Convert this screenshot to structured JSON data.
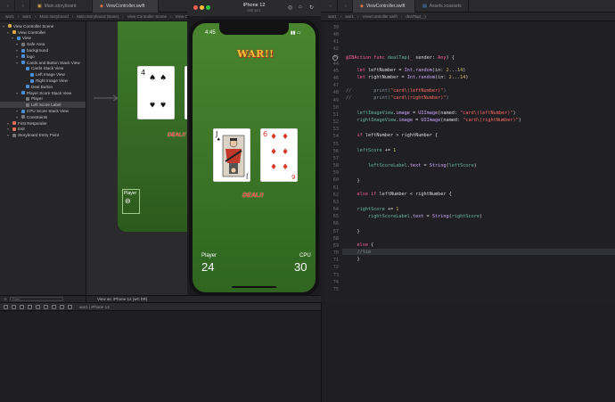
{
  "simulator": {
    "title": "iPhone 12",
    "subtitle": "iOS 14.2",
    "status_time": "4:45",
    "logo_text": "WAR!!",
    "left_card": {
      "rank": "J",
      "suit": "♠"
    },
    "right_card": {
      "rank": "6",
      "suit": "♦"
    },
    "deal_label": "DEAL!!",
    "player_label": "Player",
    "player_score": "24",
    "cpu_label": "CPU",
    "cpu_score": "30"
  },
  "storyboard": {
    "preview_card_left": {
      "rank": "4",
      "suit": "♠"
    },
    "preview_deal": "DEAL!!",
    "preview_player_label": "Player"
  },
  "tabs": {
    "left": [
      "Main.storyboard",
      "ViewController.swift"
    ],
    "right": [
      "ViewController.swift",
      "Assets.xcassets"
    ]
  },
  "breadcrumbs": {
    "left": [
      "war1",
      "war1",
      "Main.storyboard",
      "Main.storyboard (Base)",
      "View Controller Scene",
      "View Controller"
    ],
    "right": [
      "war1",
      "war1",
      "ViewController.swift",
      "dealTap(_:)"
    ]
  },
  "navigator": {
    "items": [
      {
        "label": "View Controller Scene",
        "indent": 0,
        "icon": "y"
      },
      {
        "label": "View Controller",
        "indent": 1,
        "icon": "y"
      },
      {
        "label": "View",
        "indent": 2,
        "icon": "b"
      },
      {
        "label": "Safe Area",
        "indent": 3,
        "icon": "g"
      },
      {
        "label": "background",
        "indent": 3,
        "icon": "b"
      },
      {
        "label": "logo",
        "indent": 3,
        "icon": "b"
      },
      {
        "label": "Cards and Button Stack View",
        "indent": 3,
        "icon": "b"
      },
      {
        "label": "Cards Stack View",
        "indent": 4,
        "icon": "b"
      },
      {
        "label": "Left Image View",
        "indent": 5,
        "icon": "b"
      },
      {
        "label": "Right Image View",
        "indent": 5,
        "icon": "b"
      },
      {
        "label": "Deal Button",
        "indent": 4,
        "icon": "b"
      },
      {
        "label": "Player Score Stack View",
        "indent": 3,
        "icon": "b"
      },
      {
        "label": "Player",
        "indent": 4,
        "icon": "g"
      },
      {
        "label": "Left Score Label",
        "indent": 4,
        "icon": "g",
        "selected": true
      },
      {
        "label": "CPU Score Stack View",
        "indent": 3,
        "icon": "b"
      },
      {
        "label": "Constraints",
        "indent": 3,
        "icon": "g"
      },
      {
        "label": "First Responder",
        "indent": 1,
        "icon": "r"
      },
      {
        "label": "Exit",
        "indent": 1,
        "icon": "r"
      },
      {
        "label": "Storyboard Entry Point",
        "indent": 1,
        "icon": "g"
      }
    ],
    "filter_placeholder": "Filter"
  },
  "canvas_bar": {
    "label": "View as: iPhone 12 (wC hR)"
  },
  "debug_bar": {
    "target": "war1 | iPhone 12"
  },
  "editor": {
    "line_numbers": [
      "39",
      "40",
      "41",
      "42",
      "43",
      "44",
      "45",
      "46",
      "47",
      "48",
      "49",
      "50",
      "51",
      "52",
      "53",
      "54",
      "55",
      "56",
      "57",
      "58",
      "59",
      "60",
      "61",
      "62",
      "63",
      "64",
      "65",
      "66",
      "67",
      "68",
      "69",
      "70",
      "71",
      "72",
      "73",
      "74",
      "75"
    ]
  }
}
